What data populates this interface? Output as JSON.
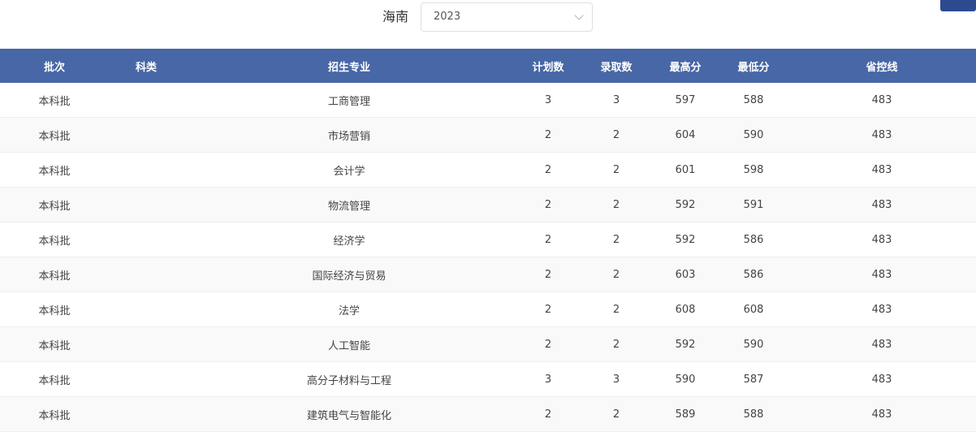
{
  "filter": {
    "province": "海南",
    "year": "2023"
  },
  "table": {
    "headers": {
      "batch": "批次",
      "category": "科类",
      "major": "招生专业",
      "plan": "计划数",
      "admitted": "录取数",
      "max": "最高分",
      "min": "最低分",
      "control": "省控线"
    },
    "rows": [
      {
        "batch": "本科批",
        "category": "",
        "major": "工商管理",
        "plan": "3",
        "admitted": "3",
        "max": "597",
        "min": "588",
        "control": "483"
      },
      {
        "batch": "本科批",
        "category": "",
        "major": "市场营销",
        "plan": "2",
        "admitted": "2",
        "max": "604",
        "min": "590",
        "control": "483"
      },
      {
        "batch": "本科批",
        "category": "",
        "major": "会计学",
        "plan": "2",
        "admitted": "2",
        "max": "601",
        "min": "598",
        "control": "483"
      },
      {
        "batch": "本科批",
        "category": "",
        "major": "物流管理",
        "plan": "2",
        "admitted": "2",
        "max": "592",
        "min": "591",
        "control": "483"
      },
      {
        "batch": "本科批",
        "category": "",
        "major": "经济学",
        "plan": "2",
        "admitted": "2",
        "max": "592",
        "min": "586",
        "control": "483"
      },
      {
        "batch": "本科批",
        "category": "",
        "major": "国际经济与贸易",
        "plan": "2",
        "admitted": "2",
        "max": "603",
        "min": "586",
        "control": "483"
      },
      {
        "batch": "本科批",
        "category": "",
        "major": "法学",
        "plan": "2",
        "admitted": "2",
        "max": "608",
        "min": "608",
        "control": "483"
      },
      {
        "batch": "本科批",
        "category": "",
        "major": "人工智能",
        "plan": "2",
        "admitted": "2",
        "max": "592",
        "min": "590",
        "control": "483"
      },
      {
        "batch": "本科批",
        "category": "",
        "major": "高分子材料与工程",
        "plan": "3",
        "admitted": "3",
        "max": "590",
        "min": "587",
        "control": "483"
      },
      {
        "batch": "本科批",
        "category": "",
        "major": "建筑电气与智能化",
        "plan": "2",
        "admitted": "2",
        "max": "589",
        "min": "588",
        "control": "483"
      }
    ]
  }
}
